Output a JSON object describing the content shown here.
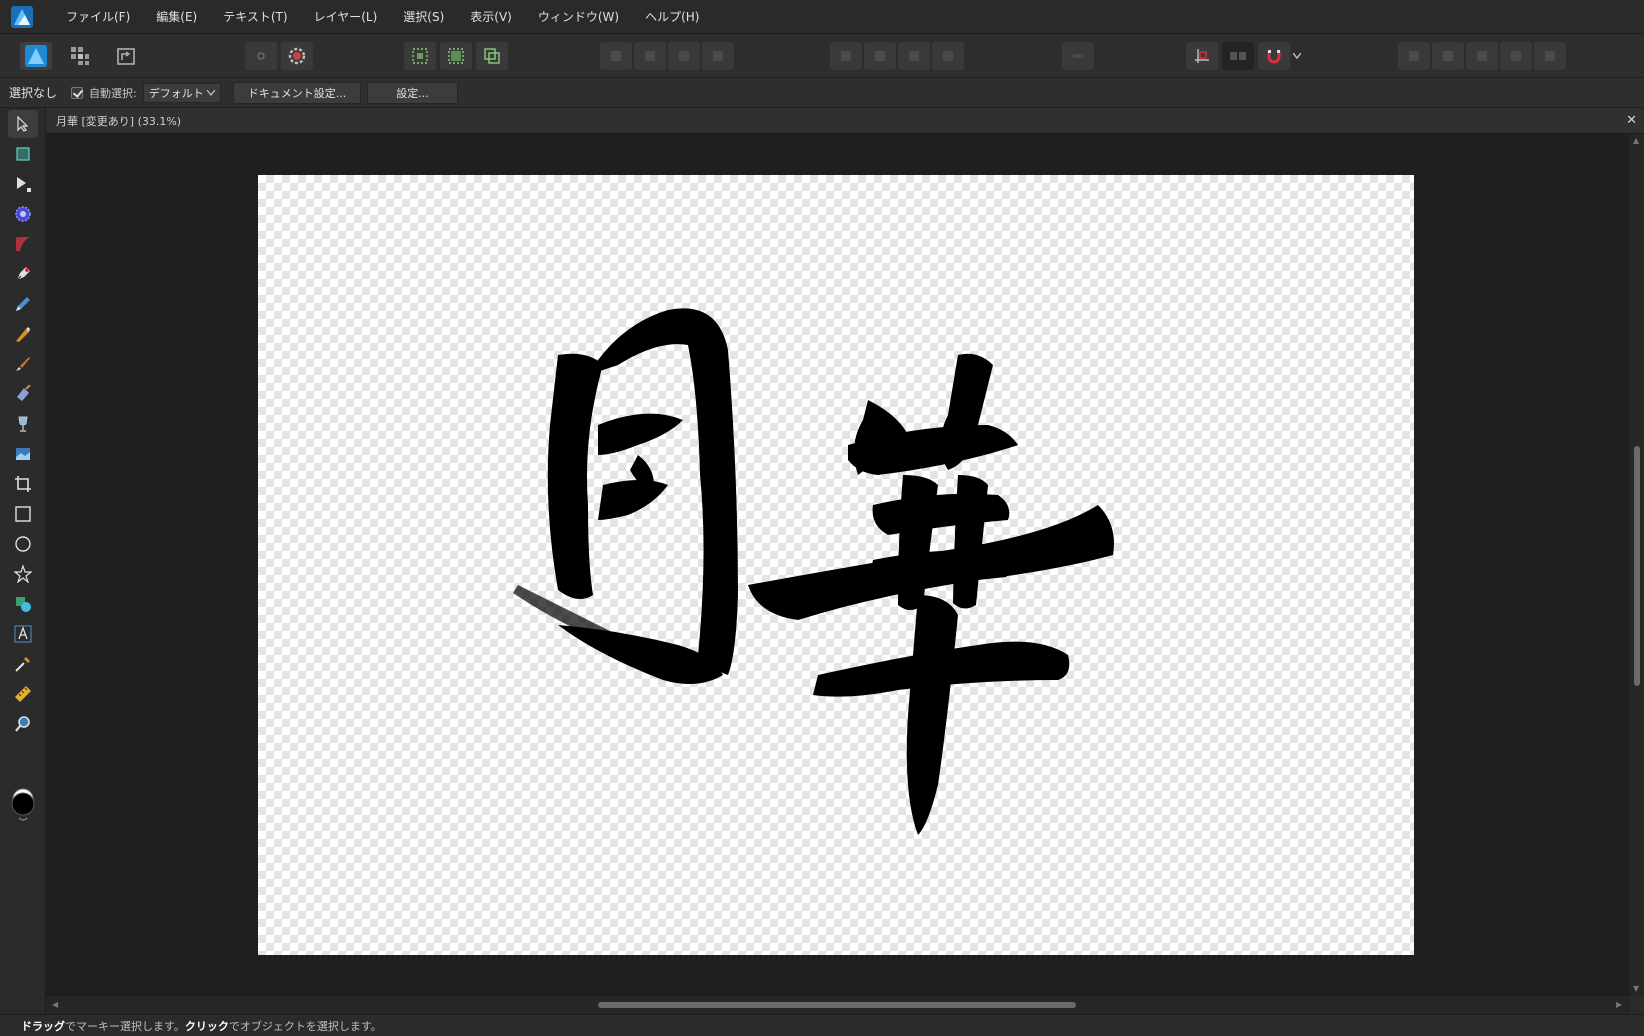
{
  "menu": {
    "items": [
      "ファイル(F)",
      "編集(E)",
      "テキスト(T)",
      "レイヤー(L)",
      "選択(S)",
      "表示(V)",
      "ウィンドウ(W)",
      "ヘルプ(H)"
    ]
  },
  "context": {
    "selection_status": "選択なし",
    "auto_select_label": "自動選択:",
    "auto_select_value": "デフォルト",
    "doc_setup_button": "ドキュメント設定...",
    "settings_button": "設定..."
  },
  "document": {
    "tab_title": "月華 [変更あり] (33.1%)",
    "close_glyph": "✕"
  },
  "tools": [
    "move-tool",
    "artboard-tool",
    "node-tool",
    "corner-tool",
    "point-transform-tool",
    "pen-tool",
    "pencil-tool",
    "vector-brush-tool",
    "paint-brush-tool",
    "fill-tool",
    "transparency-tool",
    "place-image-tool",
    "crop-tool",
    "rectangle-tool",
    "ellipse-tool",
    "star-tool",
    "shape-builder-tool",
    "artistic-text-tool",
    "color-picker-tool",
    "measure-tool",
    "zoom-tool"
  ],
  "status": {
    "drag_word": "ドラッグ",
    "drag_text": "でマーキー選択します。",
    "click_word": "クリック",
    "click_text": "でオブジェクトを選択します。"
  },
  "colors": {
    "accent": "#29a0e6",
    "snap_accent": "#d8323c",
    "canvas_ink": "#000000"
  }
}
